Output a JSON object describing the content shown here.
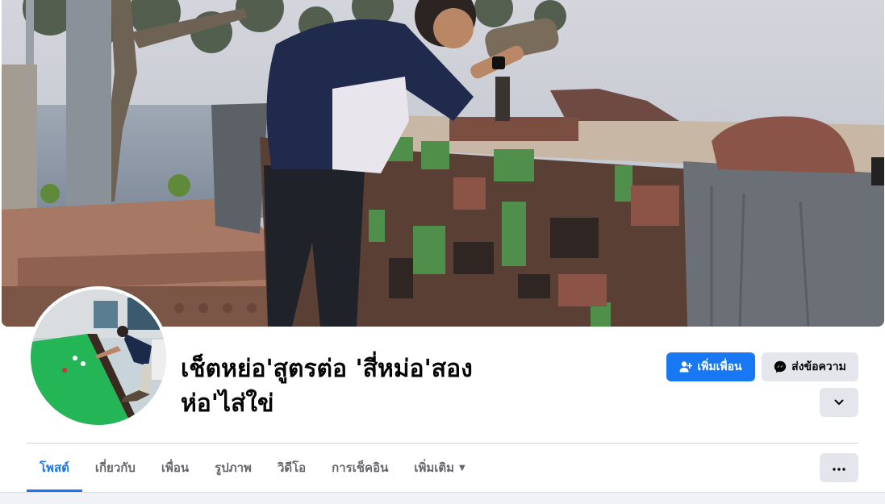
{
  "profile": {
    "name": "เช็ตหย่อ'สูตรต่อ 'สี่หม่อ'สอง ห่อ'ไส่ใข่"
  },
  "actions": {
    "add_friend_label": "เพิ่มเพื่อน",
    "message_label": "ส่งข้อความ"
  },
  "tabs": [
    {
      "label": "โพสต์",
      "active": true
    },
    {
      "label": "เกี่ยวกับ",
      "active": false
    },
    {
      "label": "เพื่อน",
      "active": false
    },
    {
      "label": "รูปภาพ",
      "active": false
    },
    {
      "label": "วิดีโอ",
      "active": false
    },
    {
      "label": "การเช็คอิน",
      "active": false
    },
    {
      "label": "เพิ่มเติม",
      "active": false
    }
  ],
  "icons": {
    "add_friend": "person-plus-icon",
    "message": "messenger-icon",
    "expand": "chevron-down-icon",
    "more": "ellipsis-icon",
    "tab_more_caret": "caret-down-icon"
  },
  "colors": {
    "accent": "#1877f2",
    "button_gray": "#e4e6eb",
    "tab_text": "#65676b",
    "page_bg": "#f0f2f5"
  }
}
